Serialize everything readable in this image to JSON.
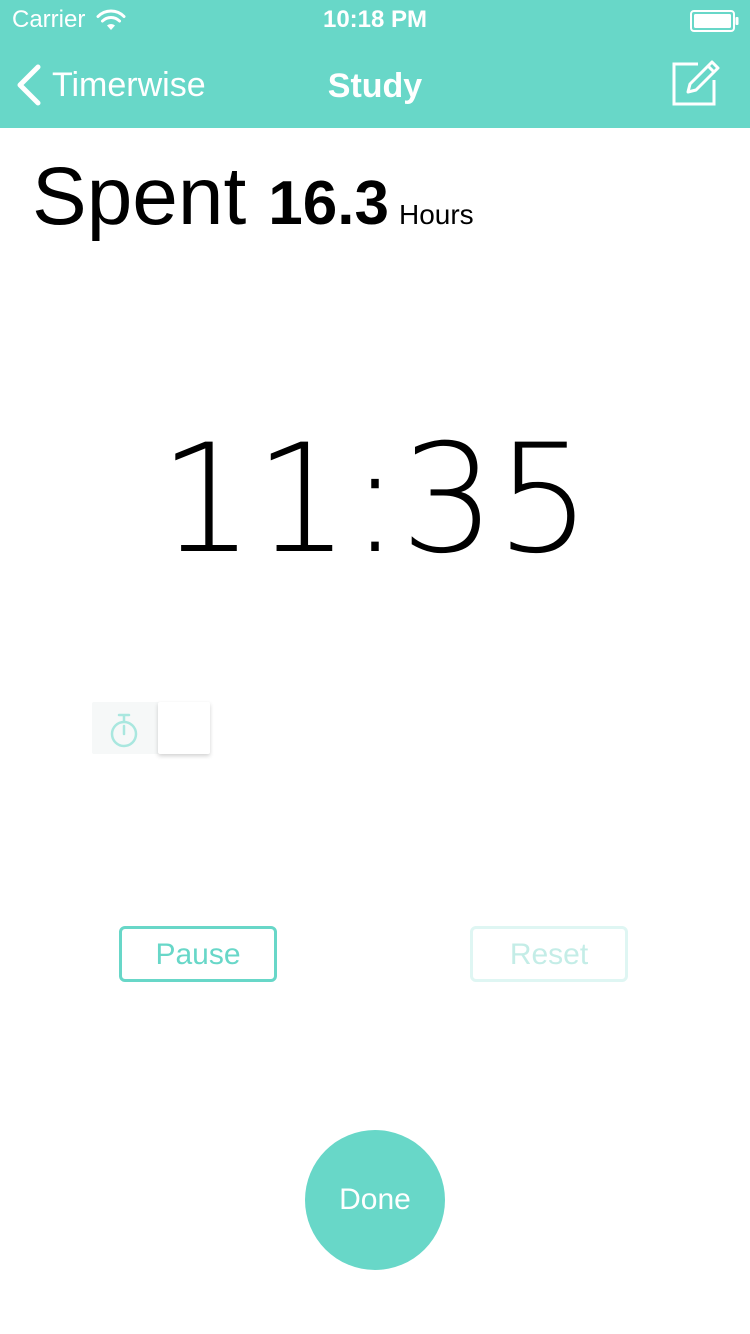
{
  "status_bar": {
    "carrier": "Carrier",
    "time": "10:18 PM",
    "wifi_icon": "wifi-icon",
    "battery_icon": "battery-icon"
  },
  "nav": {
    "back_label": "Timerwise",
    "title": "Study",
    "edit_icon": "compose-icon"
  },
  "spent": {
    "label": "Spent",
    "value": "16.3",
    "unit": "Hours"
  },
  "timer": {
    "display": "11:35"
  },
  "toggle": {
    "icon": "stopwatch-icon",
    "state": "off"
  },
  "controls": {
    "pause_label": "Pause",
    "reset_label": "Reset",
    "done_label": "Done"
  },
  "colors": {
    "accent": "#68d7c8",
    "reset_disabled": "#c4ede7",
    "text": "#000000",
    "background": "#ffffff"
  }
}
